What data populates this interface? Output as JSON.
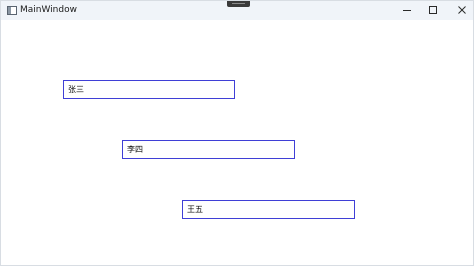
{
  "window": {
    "title": "MainWindow",
    "icon": "app-window-icon",
    "controls": {
      "minimize_icon": "minimize-icon",
      "maximize_icon": "maximize-icon",
      "close_icon": "close-icon"
    }
  },
  "textboxes": [
    {
      "value": "张三"
    },
    {
      "value": "李四"
    },
    {
      "value": "王五"
    }
  ],
  "colors": {
    "titlebar_bg": "#f0f4f9",
    "textbox_border": "#3f3fd6",
    "window_bg": "#ffffff"
  }
}
